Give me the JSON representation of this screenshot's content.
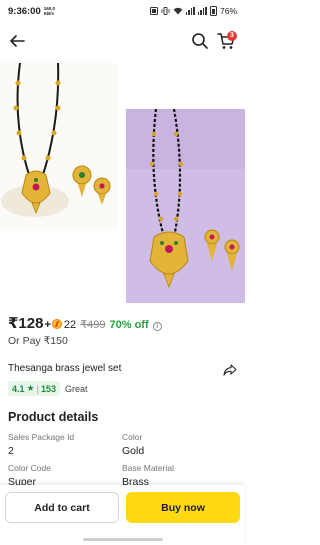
{
  "status_bar": {
    "time": "9:36:00",
    "speed_value": "160.0",
    "speed_unit": "KB/s",
    "battery": "76%"
  },
  "header": {
    "cart_count": "3"
  },
  "gallery": {
    "image_alt_1": "Gold-tone mangalsutra necklace with black beads and matching earrings on white background",
    "image_alt_2": "Gold-tone mangalsutra necklace with black beads and matching earrings on lavender background"
  },
  "price": {
    "current": "₹128",
    "plus": "+",
    "coins": "22",
    "mrp": "₹499",
    "discount": "70% off",
    "info_glyph": "i"
  },
  "or_pay": "Or Pay ₹150",
  "product": {
    "title": "Thesanga brass jewel set",
    "rating": "4.1",
    "rating_star": "★",
    "rating_separator": "|",
    "rating_count": "153",
    "rating_label": "Great"
  },
  "details": {
    "section_title": "Product details",
    "items": [
      {
        "label": "Sales Package Id",
        "value": "2"
      },
      {
        "label": "Color",
        "value": "Gold"
      },
      {
        "label": "Color Code",
        "value": "Super"
      },
      {
        "label": "Base Material",
        "value": "Brass"
      }
    ]
  },
  "actions": {
    "add_to_cart": "Add to cart",
    "buy_now": "Buy now"
  },
  "colors": {
    "discount_green": "#26a541",
    "buy_now_yellow": "#ffd814",
    "badge_red": "#e53935",
    "photo2_background": "#c9b3e0"
  }
}
